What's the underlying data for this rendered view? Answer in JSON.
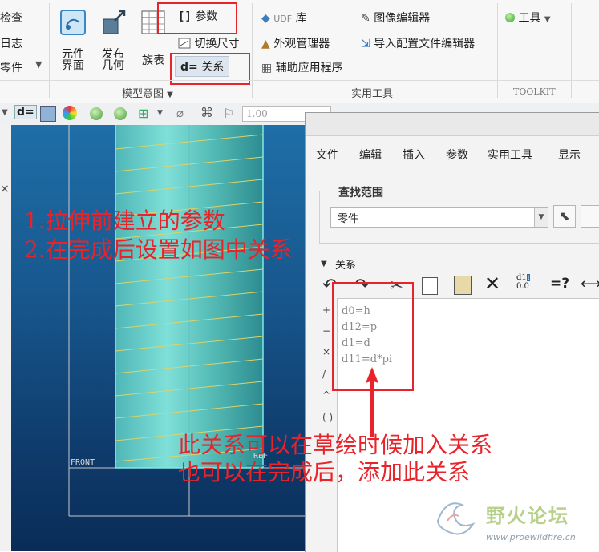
{
  "ribbon": {
    "left_items": [
      "检查",
      "日志",
      "零件"
    ],
    "buttons": {
      "element_line1": "元件",
      "element_line2": "界面",
      "publish_line1": "发布",
      "publish_line2": "几何",
      "family_table": "族表"
    },
    "params": "参数",
    "switch_dims": "切换尺寸",
    "relations": "关系",
    "relations_prefix": "d=",
    "udf": "库",
    "udf_prefix": "UDF",
    "appearance": "外观管理器",
    "aux_apps": "辅助应用程序",
    "image_editor": "图像编辑器",
    "import_config": "导入配置文件编辑器",
    "tools": "工具",
    "groups": {
      "model_intent": "模型意图",
      "utilities": "实用工具",
      "toolkit": "TOOLKIT"
    }
  },
  "graphics_toolbar": {
    "scale_value": "1.00",
    "d_label": "d="
  },
  "model": {
    "front_label": "FRONT",
    "ref_label": "REF"
  },
  "dialog": {
    "menu": [
      "文件",
      "编辑",
      "插入",
      "参数",
      "实用工具",
      "显示"
    ],
    "scope_title": "查找范围",
    "scope_value": "零件",
    "relations_section": "关系",
    "relations": [
      "d0=h",
      "d12=p",
      "d1=d",
      "d11=d*pi"
    ],
    "side_symbols": [
      "+",
      "−",
      "×",
      "/",
      "^",
      "( )"
    ],
    "toolbar_text_d1": "d1",
    "toolbar_text_00": "0.0",
    "toolbar_eq": "=?"
  },
  "annotations": {
    "step1": "1.拉伸前建立的参数",
    "step2": "2.在完成后设置如图中关系",
    "note1": "此关系可以在草绘时候加入关系",
    "note2": "也可以在完成后，添加此关系"
  },
  "watermark": {
    "name": "野火论坛",
    "url": "www.proewildfire.cn"
  },
  "colors": {
    "annotation_red": "#e8232a",
    "model_blue": "#1f6ea8",
    "cylinder_teal": "#5fc9c6",
    "thread_yellow": "#d9d36a"
  }
}
